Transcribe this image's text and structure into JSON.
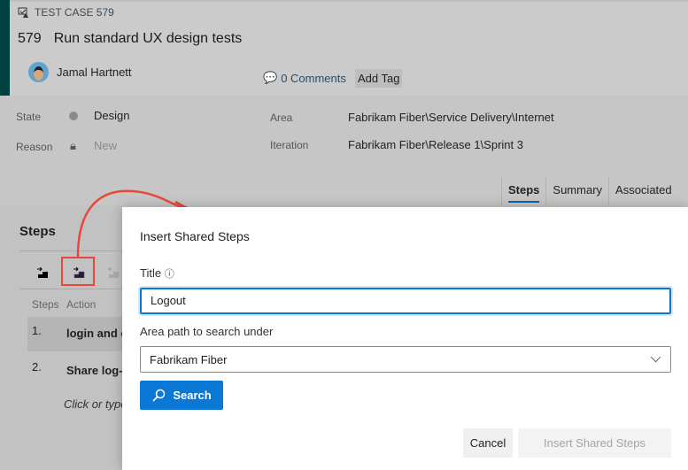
{
  "work_item": {
    "type_label": "TEST CASE 579",
    "id": "579",
    "title": "Run standard UX design tests",
    "author": "Jamal Hartnett",
    "comments": "0 Comments",
    "add_tag": "Add Tag"
  },
  "fields": {
    "state_label": "State",
    "state_value": "Design",
    "reason_label": "Reason",
    "reason_value": "New",
    "area_label": "Area",
    "area_value": "Fabrikam Fiber\\Service Delivery\\Internet",
    "iteration_label": "Iteration",
    "iteration_value": "Fabrikam Fiber\\Release 1\\Sprint 3"
  },
  "tabs": [
    {
      "label": "Steps"
    },
    {
      "label": "Summary"
    },
    {
      "label": "Associated"
    }
  ],
  "steps": {
    "heading": "Steps",
    "col_steps": "Steps",
    "col_action": "Action",
    "rows": [
      {
        "num": "1.",
        "action": "login and c"
      },
      {
        "num": "2.",
        "action": "Share log-"
      }
    ],
    "placeholder": "Click or type"
  },
  "dialog": {
    "title": "Insert Shared Steps",
    "title_label": "Title",
    "title_value": "Logout",
    "area_label": "Area path to search under",
    "area_value": "Fabrikam Fiber",
    "search": "Search",
    "cancel": "Cancel",
    "insert": "Insert Shared Steps"
  },
  "colors": {
    "accent": "#0a78d4",
    "highlight": "#e8483a",
    "bar": "#00403f"
  }
}
